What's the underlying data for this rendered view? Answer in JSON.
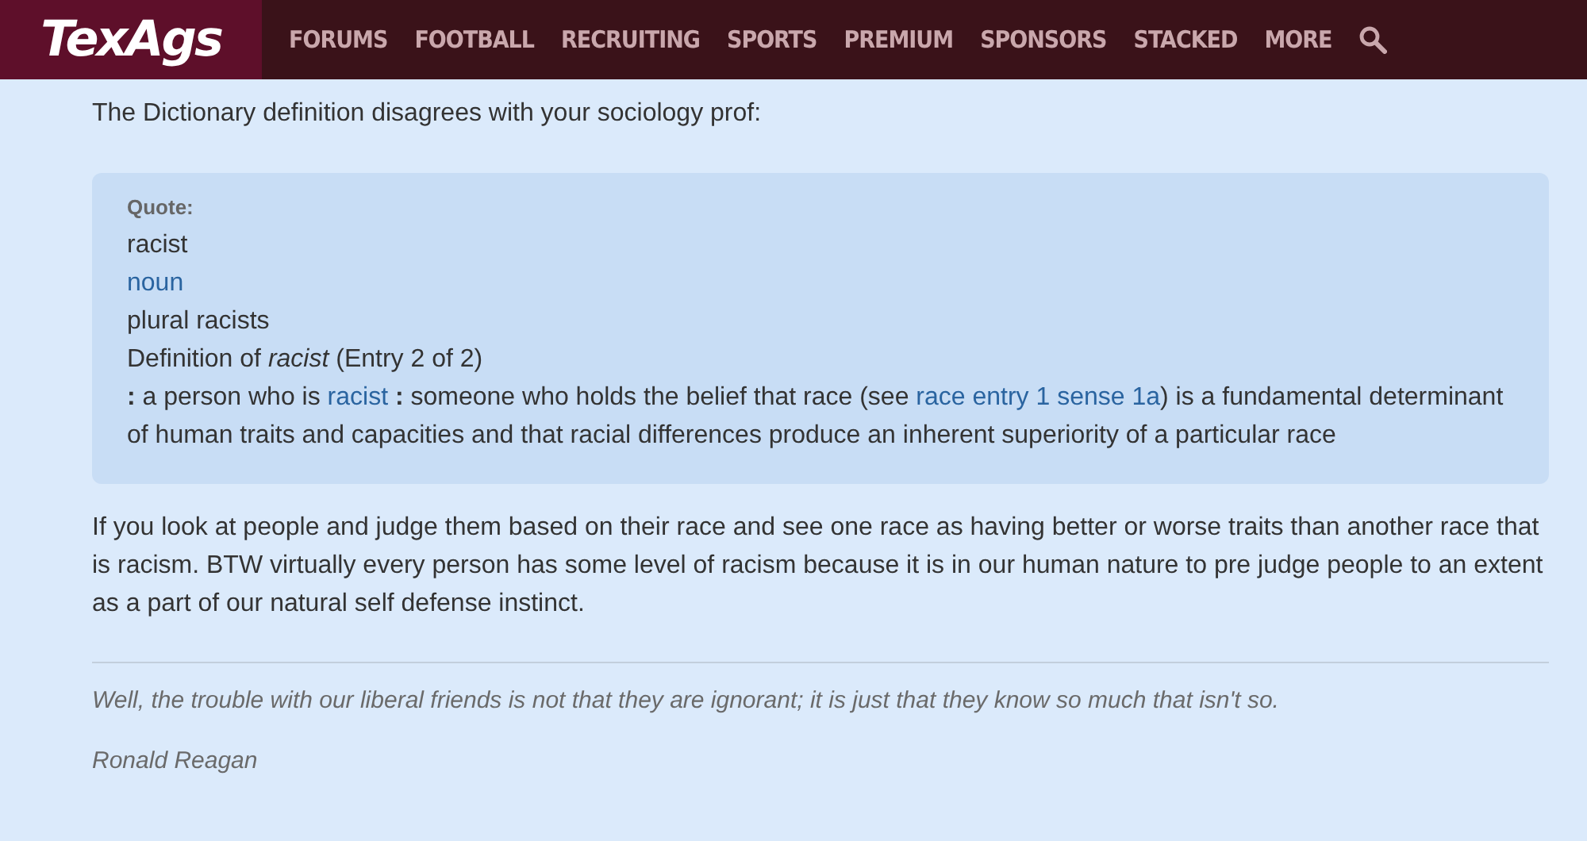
{
  "header": {
    "logo": "TexAgs",
    "nav": [
      {
        "label": "FORUMS"
      },
      {
        "label": "FOOTBALL"
      },
      {
        "label": "RECRUITING"
      },
      {
        "label": "SPORTS"
      },
      {
        "label": "PREMIUM"
      },
      {
        "label": "SPONSORS"
      },
      {
        "label": "STACKED"
      },
      {
        "label": "MORE"
      }
    ]
  },
  "post": {
    "intro": "The Dictionary definition disagrees with your sociology prof:",
    "quote": {
      "label": "Quote:",
      "lines": [
        {
          "kind": "text",
          "text": "racist"
        },
        {
          "kind": "link",
          "text": "noun"
        },
        {
          "kind": "text",
          "text": "plural racists"
        },
        {
          "kind": "text",
          "text": "Definition of *racist* (Entry 2 of 2)"
        },
        {
          "kind": "mixed",
          "parts": [
            {
              "kind": "text",
              "text": "**:** a person who is "
            },
            {
              "kind": "link",
              "text": "racist"
            },
            {
              "kind": "text",
              "text": " **:** someone who holds the belief that race (see "
            },
            {
              "kind": "link",
              "text": "race entry 1 sense 1a"
            },
            {
              "kind": "text",
              "text": ") is a fundamental determinant of human traits and capacities and that racial differences produce an inherent superiority of a particular race"
            }
          ]
        }
      ]
    },
    "body": "If you look at people and judge them based on their race and see one race as having better or worse traits than another race that is racism. BTW virtually every person has some level of racism because it is in our human nature to pre judge people to an extent as a part of our natural self defense instinct.",
    "signature": [
      "Well, the trouble with our liberal friends is not that they are ignorant; it is just that they know so much that isn't so.",
      "Ronald Reagan"
    ]
  }
}
